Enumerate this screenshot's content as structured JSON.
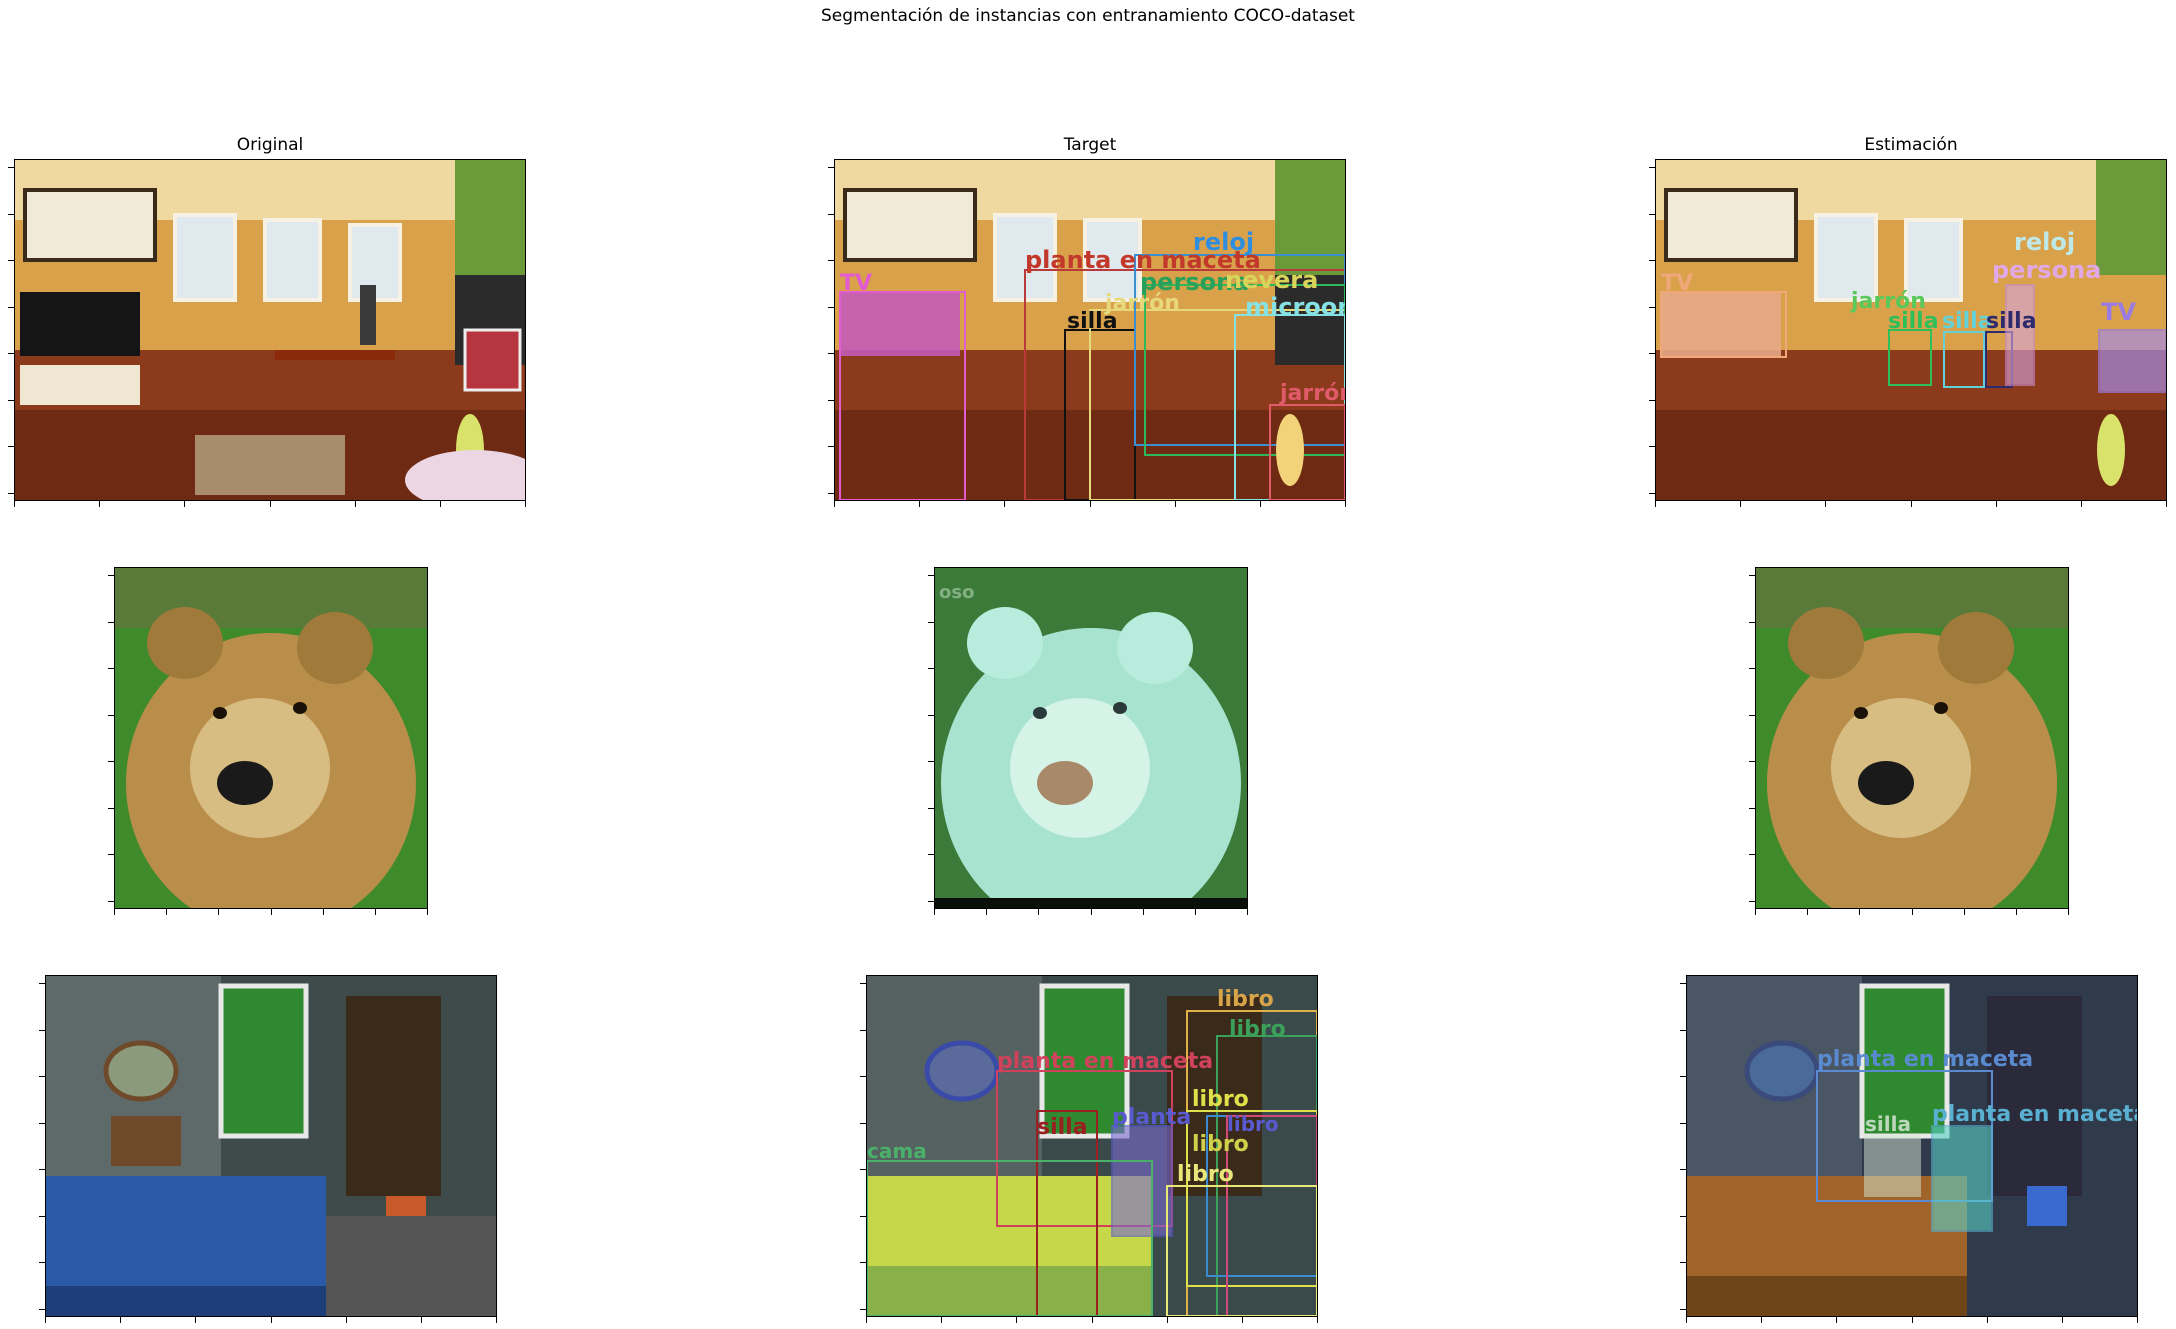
{
  "figure": {
    "suptitle": "Segmentación de instancias con entranamiento COCO-dataset",
    "columns": [
      "Original",
      "Target",
      "Estimación"
    ]
  },
  "chart_data": [
    {
      "type": "image-grid",
      "rows": 3,
      "cols": 3,
      "row_scenes": [
        "living-room",
        "bear",
        "bedroom"
      ],
      "annotations": {
        "row1_target": [
          "TV",
          "planta en maceta",
          "reloj",
          "persona",
          "nevera",
          "jarrón",
          "silla",
          "microon",
          "jarrón"
        ],
        "row1_estimacion": [
          "TV",
          "reloj",
          "persona",
          "jarrón",
          "silla",
          "silla",
          "silla",
          "TV"
        ],
        "row2_target": [
          "oso"
        ],
        "row2_estimacion": [],
        "row3_target": [
          "libro",
          "libro",
          "planta en maceta",
          "libro",
          "silla",
          "planta",
          "libro",
          "cama",
          "libro",
          "libro"
        ],
        "row3_estimacion": [
          "planta en maceta",
          "silla",
          "planta en maceta"
        ]
      }
    }
  ]
}
